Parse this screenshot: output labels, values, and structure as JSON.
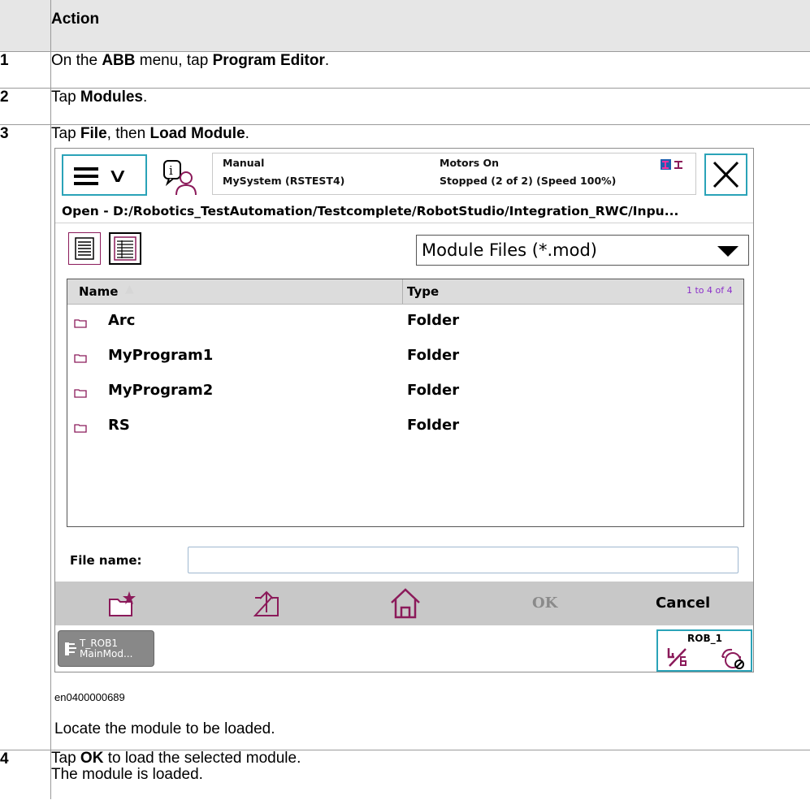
{
  "table": {
    "header": "Action",
    "rows": [
      {
        "num": "1",
        "parts": [
          "On the ",
          "ABB",
          " menu, tap ",
          "Program Editor",
          "."
        ]
      },
      {
        "num": "2",
        "parts": [
          "Tap ",
          "Modules",
          "."
        ]
      },
      {
        "num": "3",
        "parts": [
          "Tap ",
          "File",
          ", then ",
          "Load Module",
          "."
        ]
      },
      {
        "num": "4",
        "line1_parts": [
          "Tap ",
          "OK",
          " to load the selected module."
        ],
        "line2": "The module is loaded."
      }
    ],
    "step3_after": "Locate the module to be loaded.",
    "figure_id": "en0400000689"
  },
  "screen": {
    "status": {
      "mode": "Manual",
      "system": "MySystem (RSTEST4)",
      "motors": "Motors On",
      "state": "Stopped (2 of 2) (Speed 100%)"
    },
    "path": "Open  -  D:/Robotics_TestAutomation/Testcomplete/RobotStudio/Integration_RWC/Inpu...",
    "filter": "Module Files (*.mod)",
    "list": {
      "col_name": "Name",
      "col_type": "Type",
      "count": "1 to 4 of 4",
      "items": [
        {
          "name": "Arc",
          "type": "Folder"
        },
        {
          "name": "MyProgram1",
          "type": "Folder"
        },
        {
          "name": "MyProgram2",
          "type": "Folder"
        },
        {
          "name": "RS",
          "type": "Folder"
        }
      ]
    },
    "filename_label": "File name:",
    "filename_value": "",
    "ok_label": "OK",
    "cancel_label": "Cancel",
    "task": {
      "line1": "T_ROB1",
      "line2": "MainMod..."
    },
    "rob": {
      "name": "ROB_1"
    },
    "accent": "#2aa3b8",
    "icon_color": "#8b1a5a"
  }
}
